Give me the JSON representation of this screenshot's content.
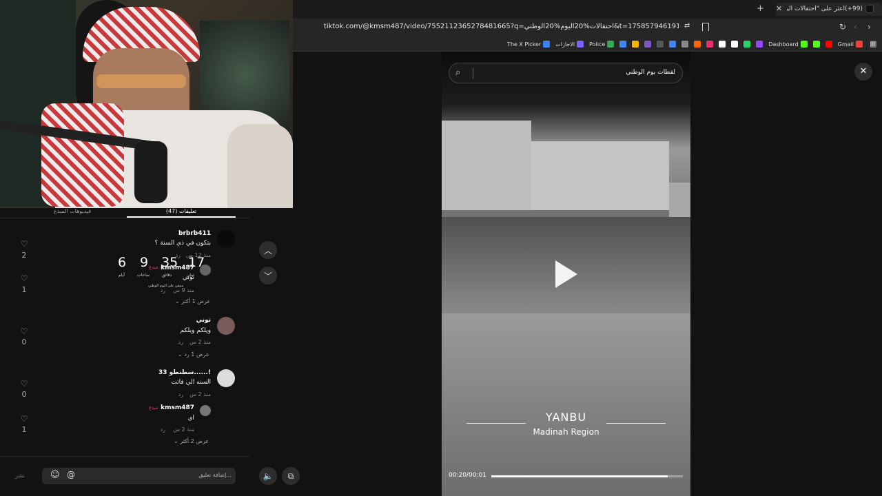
{
  "browser": {
    "tab_title": "(99+)اعثر على \"احتفالات اليوم الو...",
    "url": "tiktok.com/@kmsm487/video/7552112365278481665?q=احتفالات%20اليوم%20الوطني&t=1758579461911",
    "bookmarks": [
      {
        "label": "Gmail",
        "color": "#ea4335"
      },
      {
        "label": "",
        "color": "#ff0000"
      },
      {
        "label": "",
        "color": "#53fc18"
      },
      {
        "label": "Dashboard",
        "color": "#53fc18"
      },
      {
        "label": "",
        "color": "#9146ff"
      },
      {
        "label": "",
        "color": "#25d366"
      },
      {
        "label": "",
        "color": "#ffffff"
      },
      {
        "label": "",
        "color": "#ffffff"
      },
      {
        "label": "",
        "color": "#e1306c"
      },
      {
        "label": "",
        "color": "#ff6600"
      },
      {
        "label": "",
        "color": "#888888"
      },
      {
        "label": "",
        "color": "#4285f4"
      },
      {
        "label": "",
        "color": "#555555"
      },
      {
        "label": "",
        "color": "#7e57c2"
      },
      {
        "label": "",
        "color": "#f4b400"
      },
      {
        "label": "",
        "color": "#3b82f6"
      },
      {
        "label": "Police",
        "color": "#34a853"
      },
      {
        "label": "الاجازات",
        "color": "#7b61ff"
      },
      {
        "label": "The X Picker",
        "color": "#3b82f6"
      }
    ]
  },
  "search": {
    "value": "لقطات يوم الوطني"
  },
  "comments_panel": {
    "tabs": [
      {
        "label": "تعليقات (47)",
        "active": true
      },
      {
        "label": "فيديوهات المبدع",
        "active": false
      }
    ],
    "countdown": {
      "days": "6",
      "days_label": "أيام",
      "hours": "9",
      "hours_label": "ساعات",
      "minutes": "35",
      "minutes_label": "دقائق",
      "seconds": "17",
      "seconds_label": "ثوانٍ",
      "caption": "متبقي على اليوم الوطني"
    },
    "comments": [
      {
        "name": "brbrb411",
        "text": "بتكون في ذي السنة ؟",
        "time": "منذ 12 س",
        "reply": "رد",
        "likes": "2",
        "reply_item": {
          "name": "kmsm487",
          "badge": "مبدع",
          "text": "توني",
          "time": "منذ 9 س",
          "reply": "رد",
          "likes": "1"
        },
        "more": "عرض 1 أكثر"
      },
      {
        "name": "توني",
        "text": "ويلكم ويلكم",
        "time": "منذ 2 س",
        "reply": "رد",
        "likes": "0",
        "more": "عرض 1 رد"
      },
      {
        "name": "سطنطو 33......!",
        "text": "السنه الي فاتت",
        "time": "منذ 2 س",
        "reply": "رد",
        "likes": "0",
        "reply_item": {
          "name": "kmsm487",
          "badge": "مبدع",
          "text": "اي",
          "time": "منذ 2 س",
          "reply": "رد",
          "likes": "1"
        },
        "more": "عرض 2 أكثر"
      }
    ],
    "input_placeholder": "إضافة تعليق...",
    "post_label": "نشر"
  },
  "video": {
    "city": "YANBU",
    "region": "Madinah Region",
    "time": "00:20/00:01",
    "progress": 0.92
  },
  "colors": {
    "accent": "#fe2c55",
    "panel_bg": "#121212"
  }
}
